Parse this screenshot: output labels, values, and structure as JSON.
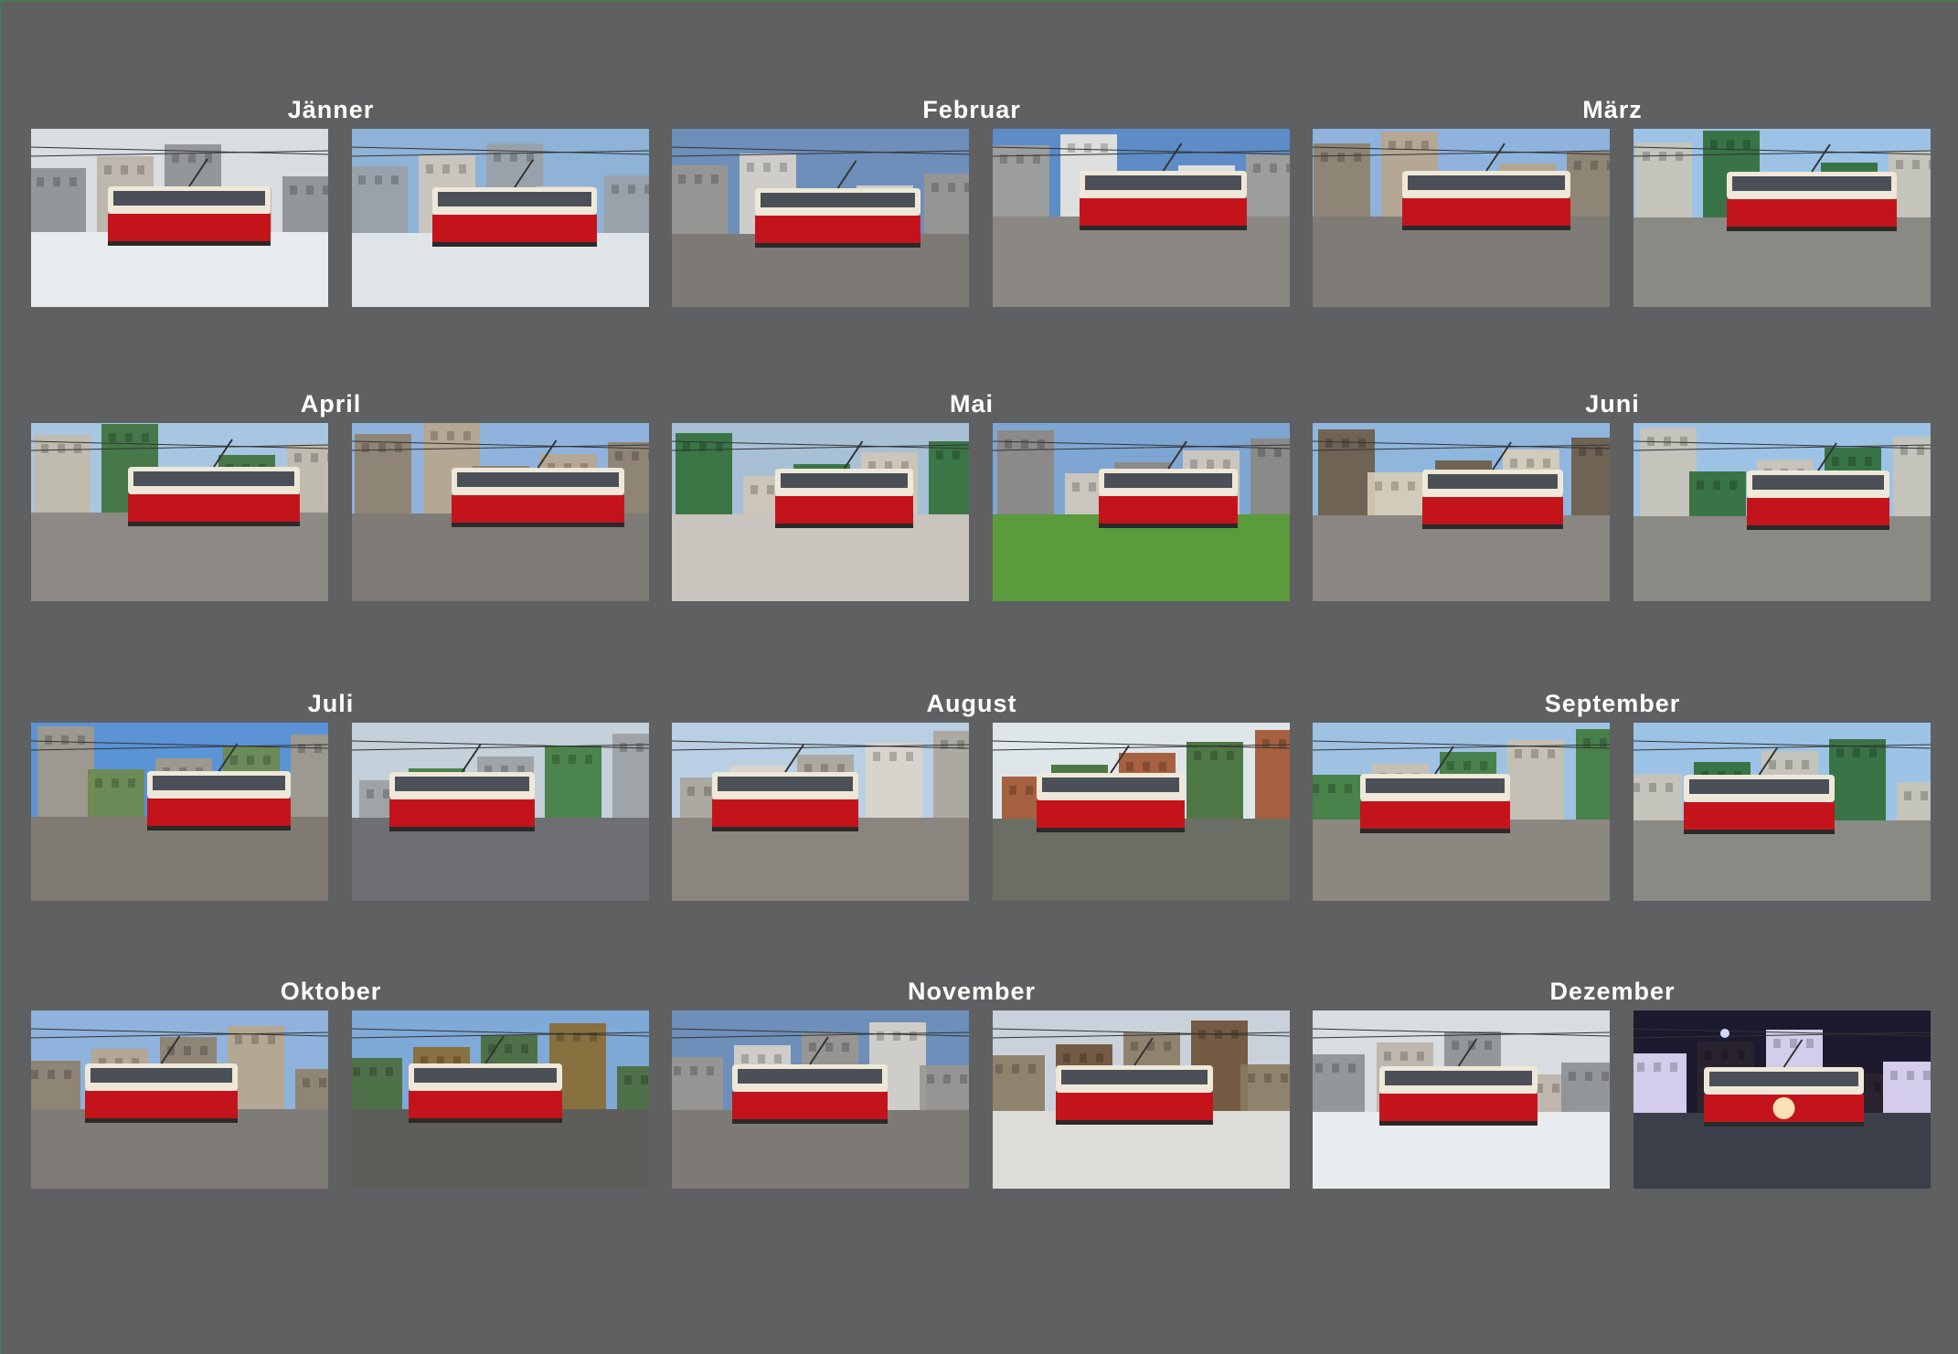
{
  "months": [
    {
      "name": "Jänner",
      "photos": [
        {
          "scene": "snow-street"
        },
        {
          "scene": "snow-square"
        }
      ]
    },
    {
      "name": "Februar",
      "photos": [
        {
          "scene": "plaza-modern"
        },
        {
          "scene": "building-white"
        }
      ]
    },
    {
      "name": "März",
      "photos": [
        {
          "scene": "street-old"
        },
        {
          "scene": "park-trees"
        }
      ]
    },
    {
      "name": "April",
      "photos": [
        {
          "scene": "plaza-trees"
        },
        {
          "scene": "street-old"
        }
      ]
    },
    {
      "name": "Mai",
      "photos": [
        {
          "scene": "church-green"
        },
        {
          "scene": "plaza-lawn"
        }
      ]
    },
    {
      "name": "Juni",
      "photos": [
        {
          "scene": "village-house"
        },
        {
          "scene": "park-trees"
        }
      ]
    },
    {
      "name": "Juli",
      "photos": [
        {
          "scene": "open-field"
        },
        {
          "scene": "rain-street"
        }
      ]
    },
    {
      "name": "August",
      "photos": [
        {
          "scene": "palace"
        },
        {
          "scene": "station-green"
        }
      ]
    },
    {
      "name": "September",
      "photos": [
        {
          "scene": "wires-plaza"
        },
        {
          "scene": "park-trees"
        }
      ]
    },
    {
      "name": "Oktober",
      "photos": [
        {
          "scene": "street-old"
        },
        {
          "scene": "autumn-trees"
        }
      ]
    },
    {
      "name": "November",
      "photos": [
        {
          "scene": "plaza-modern"
        },
        {
          "scene": "autumn-road"
        }
      ]
    },
    {
      "name": "Dezember",
      "photos": [
        {
          "scene": "snow-street"
        },
        {
          "scene": "night"
        }
      ]
    }
  ],
  "colors": {
    "background": "#5f6061",
    "title": "#ffffff",
    "tram_red": "#c4141b",
    "tram_cream": "#efe8d8"
  }
}
